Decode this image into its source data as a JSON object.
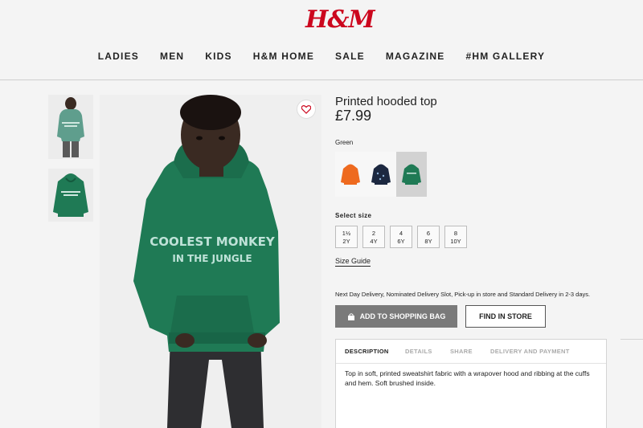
{
  "header": {
    "logo": "H&M",
    "brand_color": "#cc071e",
    "nav": [
      "LADIES",
      "MEN",
      "KIDS",
      "H&M HOME",
      "SALE",
      "MAGAZINE",
      "#HM GALLERY"
    ]
  },
  "product": {
    "title": "Printed hooded top",
    "price": "£7.99",
    "color_name": "Green",
    "swatches": [
      {
        "color": "orange",
        "hex": "#ee6a1f"
      },
      {
        "color": "navy",
        "hex": "#1c2840"
      },
      {
        "color": "green",
        "hex": "#1f7a55",
        "selected": true
      }
    ],
    "hoodie_print": [
      "COOLEST MONKEY",
      "IN THE JUNGLE"
    ],
    "select_size_label": "Select size",
    "sizes": [
      {
        "top": "1½",
        "bottom": "2Y"
      },
      {
        "top": "2",
        "bottom": "4Y"
      },
      {
        "top": "4",
        "bottom": "6Y"
      },
      {
        "top": "6",
        "bottom": "8Y"
      },
      {
        "top": "8",
        "bottom": "10Y"
      }
    ],
    "size_guide": "Size Guide",
    "delivery": "Next Day Delivery, Nominated Delivery Slot, Pick-up in store and Standard Delivery in 2-3 days.",
    "add_to_bag": "ADD TO SHOPPING BAG",
    "find_in_store": "FIND IN STORE",
    "tabs": [
      "DESCRIPTION",
      "DETAILS",
      "SHARE",
      "DELIVERY AND PAYMENT"
    ],
    "active_tab": "DESCRIPTION",
    "description": "Top in soft, printed sweatshirt fabric with a wrapover hood and ribbing at the cuffs and hem. Soft brushed inside."
  },
  "icons": {
    "favourite": "heart-icon",
    "bag": "shopping-bag-icon"
  }
}
